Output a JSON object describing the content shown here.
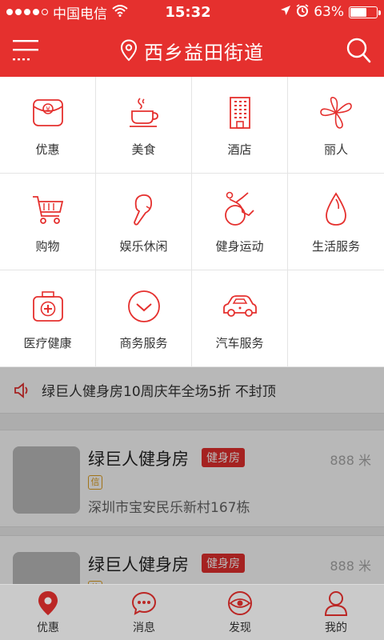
{
  "status_bar": {
    "carrier": "中国电信",
    "time": "15:32",
    "battery": "63%",
    "battery_level": 0.63
  },
  "nav": {
    "location": "西乡益田街道"
  },
  "categories": [
    {
      "label": "优惠",
      "icon": "red-envelope-icon"
    },
    {
      "label": "美食",
      "icon": "coffee-cup-icon"
    },
    {
      "label": "酒店",
      "icon": "hotel-building-icon"
    },
    {
      "label": "丽人",
      "icon": "flower-icon"
    },
    {
      "label": "购物",
      "icon": "shopping-cart-icon"
    },
    {
      "label": "娱乐休闲",
      "icon": "ice-cream-icon"
    },
    {
      "label": "健身运动",
      "icon": "fitness-ball-icon"
    },
    {
      "label": "生活服务",
      "icon": "water-drop-icon"
    },
    {
      "label": "医疗健康",
      "icon": "medical-kit-icon"
    },
    {
      "label": "商务服务",
      "icon": "check-circle-icon"
    },
    {
      "label": "汽车服务",
      "icon": "car-icon"
    }
  ],
  "announcement": {
    "text": "绿巨人健身房10周庆年全场5折 不封顶"
  },
  "listings": [
    {
      "name": "绿巨人健身房",
      "tag": "健身房",
      "distance": "888 米",
      "badge": "信",
      "address": "深圳市宝安民乐新村167栋"
    },
    {
      "name": "绿巨人健身房",
      "tag": "健身房",
      "distance": "888 米",
      "badge": "信",
      "address": ""
    }
  ],
  "tabs": [
    {
      "label": "优惠",
      "icon": "location-pin-icon",
      "active": true
    },
    {
      "label": "消息",
      "icon": "chat-bubble-icon",
      "active": false
    },
    {
      "label": "发现",
      "icon": "eye-icon",
      "active": false
    },
    {
      "label": "我的",
      "icon": "user-icon",
      "active": false
    }
  ],
  "colors": {
    "brand": "#e5302e",
    "accent_badge": "#e0a020"
  }
}
